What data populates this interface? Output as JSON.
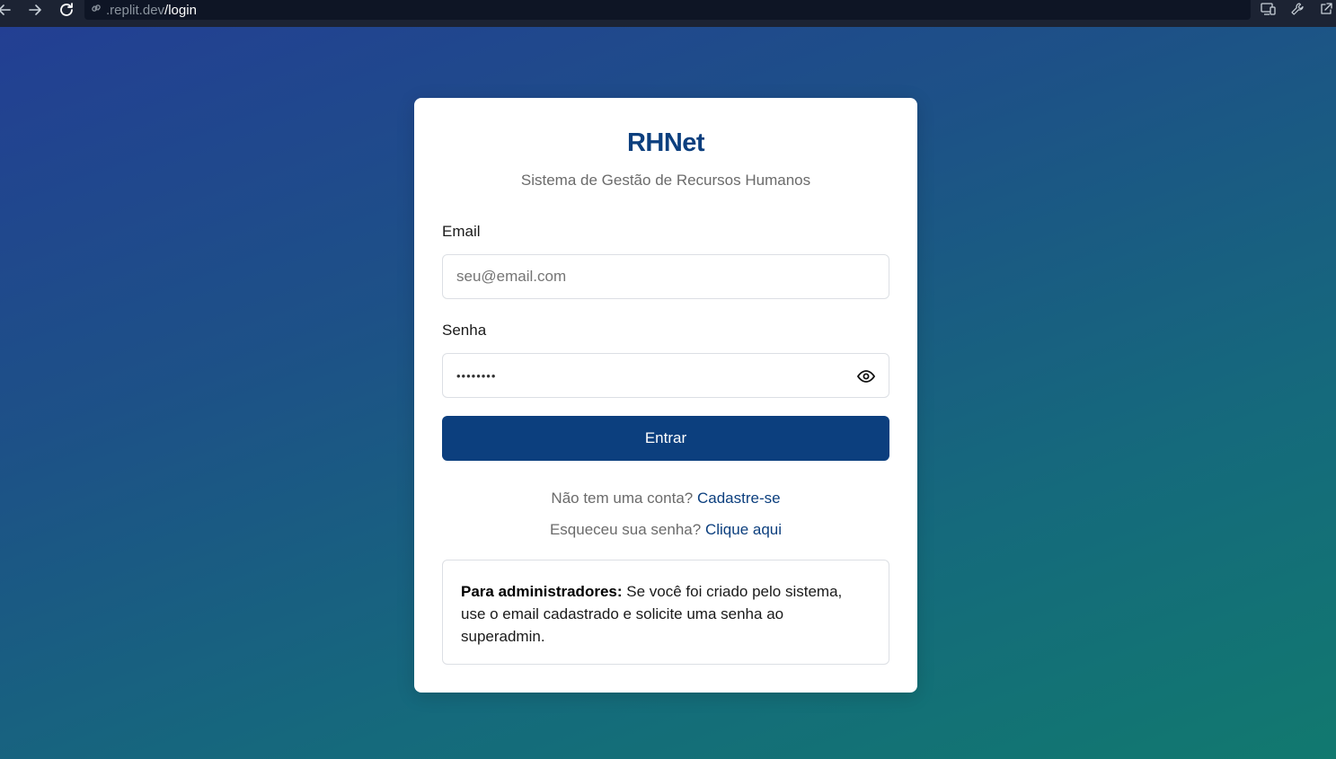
{
  "browser": {
    "url_muted": ".replit.dev",
    "url_path": "/login"
  },
  "app": {
    "title": "RHNet",
    "subtitle": "Sistema de Gestão de Recursos Humanos"
  },
  "form": {
    "email_label": "Email",
    "email_placeholder": "seu@email.com",
    "password_label": "Senha",
    "password_value": "••••••••",
    "submit_label": "Entrar"
  },
  "links": {
    "signup_prompt": "Não tem uma conta?",
    "signup_link": "Cadastre-se",
    "forgot_prompt": "Esqueceu sua senha?",
    "forgot_link": "Clique aqui"
  },
  "admin_note": {
    "bold": "Para administradores:",
    "text": " Se você foi criado pelo sistema, use o email cadastrado e solicite uma senha ao superadmin."
  },
  "colors": {
    "primary": "#0c3f7e",
    "gradient_start": "#233f93",
    "gradient_end": "#11796f"
  },
  "icons": {
    "back": "arrow-left-icon",
    "forward": "arrow-right-icon",
    "reload": "reload-icon",
    "link": "link-icon",
    "devices": "devices-icon",
    "wrench": "wrench-icon",
    "external": "external-link-icon",
    "eye": "eye-icon"
  }
}
